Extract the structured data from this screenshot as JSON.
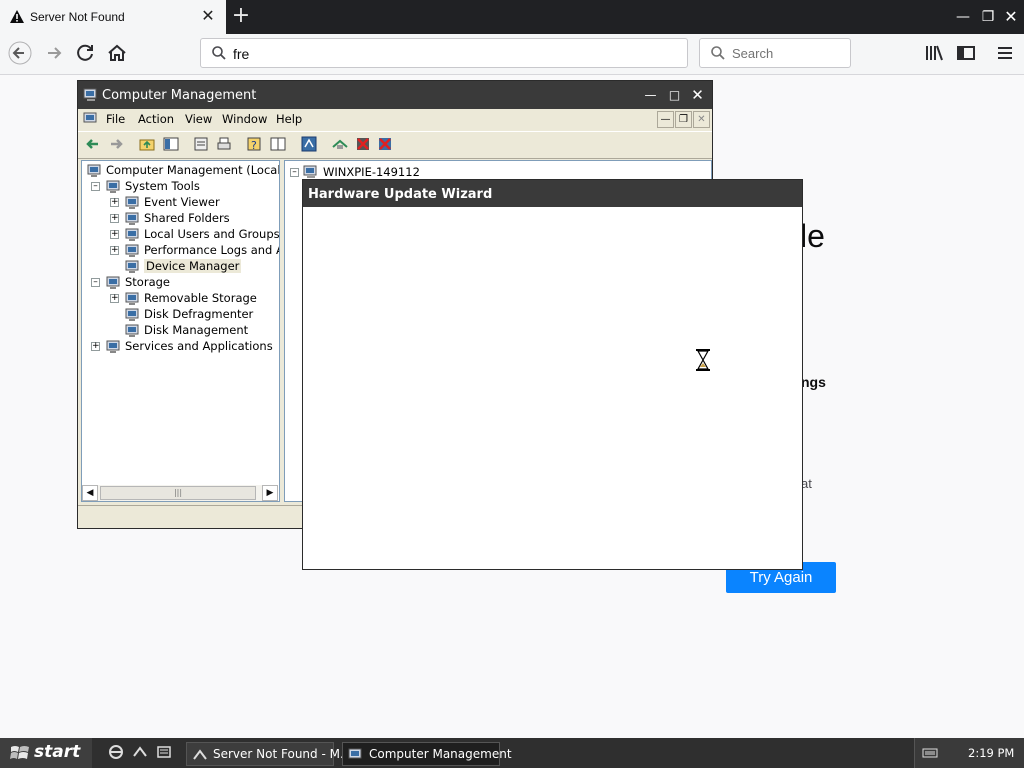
{
  "browser": {
    "tab_title": "Server Not Found",
    "url_value": "fre",
    "search_placeholder": "Search"
  },
  "error_page": {
    "title_fragment": "le",
    "heading_fragment": "ngs",
    "body_fragment": "at",
    "try_again_label": "Try Again",
    "accent": "#0a84ff"
  },
  "computer_management": {
    "title": "Computer Management",
    "menu": [
      "File",
      "Action",
      "View",
      "Window",
      "Help"
    ],
    "tree": [
      {
        "label": "Computer Management (Local)",
        "icon": "computer-icon",
        "expander": "none"
      },
      {
        "label": "System Tools",
        "icon": "tools-icon",
        "expander": "minus"
      },
      {
        "label": "Event Viewer",
        "icon": "event-viewer-icon",
        "expander": "plus"
      },
      {
        "label": "Shared Folders",
        "icon": "folder-icon",
        "expander": "plus"
      },
      {
        "label": "Local Users and Groups",
        "icon": "users-icon",
        "expander": "plus"
      },
      {
        "label": "Performance Logs and Alerts",
        "icon": "performance-icon",
        "expander": "plus"
      },
      {
        "label": "Device Manager",
        "icon": "device-manager-icon",
        "expander": "none"
      },
      {
        "label": "Storage",
        "icon": "storage-icon",
        "expander": "minus"
      },
      {
        "label": "Removable Storage",
        "icon": "removable-storage-icon",
        "expander": "plus"
      },
      {
        "label": "Disk Defragmenter",
        "icon": "defrag-icon",
        "expander": "none"
      },
      {
        "label": "Disk Management",
        "icon": "disk-management-icon",
        "expander": "none"
      },
      {
        "label": "Services and Applications",
        "icon": "services-icon",
        "expander": "plus"
      }
    ],
    "right_pane_root": "WINXPIE-149112"
  },
  "wizard": {
    "title": "Hardware Update Wizard"
  },
  "taskbar": {
    "start_label": "start",
    "tasks": [
      "Server Not Found - M...",
      "Computer Management"
    ],
    "clock": "2:19 PM"
  }
}
